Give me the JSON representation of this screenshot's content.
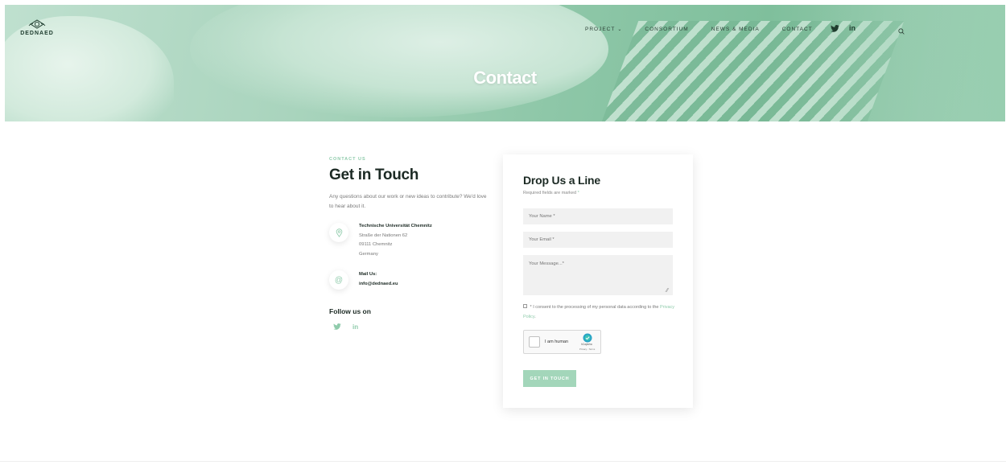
{
  "brand": {
    "name": "DEDNAED"
  },
  "nav": {
    "items": [
      {
        "label": "PROJECT",
        "has_dropdown": true
      },
      {
        "label": "CONSORTIUM"
      },
      {
        "label": "NEWS & MEDIA"
      },
      {
        "label": "CONTACT"
      }
    ],
    "social": [
      {
        "icon": "twitter-icon"
      },
      {
        "icon": "linkedin-icon",
        "label": "in"
      }
    ],
    "search_icon": "search-icon"
  },
  "hero": {
    "title": "Contact"
  },
  "contact": {
    "eyebrow": "CONTACT US",
    "heading": "Get in Touch",
    "intro": "Any questions about our work or new ideas to contribute? We'd love to hear about it.",
    "address": {
      "name": "Technische Universität Chemnitz",
      "line1": "Straße der Nationen 62",
      "line2": "09111 Chemnitz",
      "line3": "Germany"
    },
    "mail": {
      "label": "Mail Us:",
      "value": "info@dednaed.eu"
    },
    "follow_heading": "Follow us on",
    "follow_social": [
      {
        "icon": "twitter-icon"
      },
      {
        "icon": "linkedin-icon",
        "label": "in"
      }
    ]
  },
  "form": {
    "title": "Drop Us a Line",
    "required_note": "Required fields are marked",
    "required_mark": "*",
    "name_placeholder": "Your Name *",
    "email_placeholder": "Your Email *",
    "message_placeholder": "Your Message...*",
    "consent_prefix": "* I consent to the processing of my personal data according to the",
    "consent_link": "Privacy Policy",
    "consent_suffix": ".",
    "captcha": {
      "label": "I am human",
      "brand": "hCaptcha",
      "terms": "Privacy - Terms"
    },
    "submit_label": "GET IN TOUCH"
  },
  "colors": {
    "accent": "#8fcbab",
    "button": "#a3d6ba",
    "hero": "#8ec7a8"
  }
}
